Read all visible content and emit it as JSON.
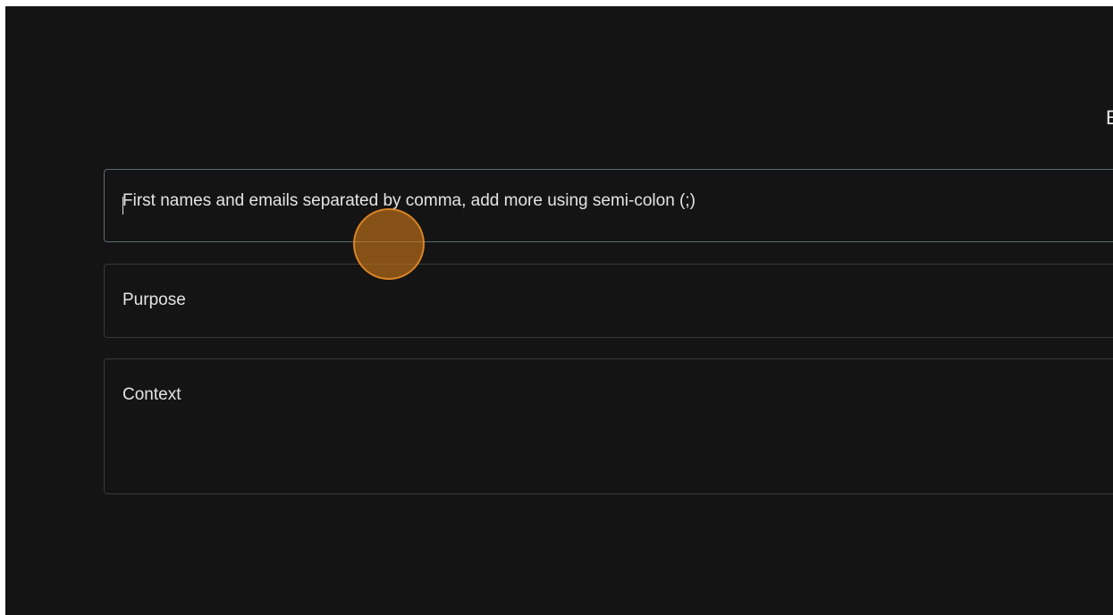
{
  "header": {
    "title_fragment": "E"
  },
  "form": {
    "people_field": {
      "placeholder": "First names and emails separated by comma, add more using semi-colon (;)"
    },
    "purpose_field": {
      "placeholder": "Purpose"
    },
    "context_field": {
      "placeholder": "Context"
    }
  },
  "colors": {
    "background": "#141414",
    "field_border": "#3a3a3a",
    "active_border": "#5b6a72",
    "text": "#e4e4e4",
    "cursor_highlight": "#cd7819"
  }
}
